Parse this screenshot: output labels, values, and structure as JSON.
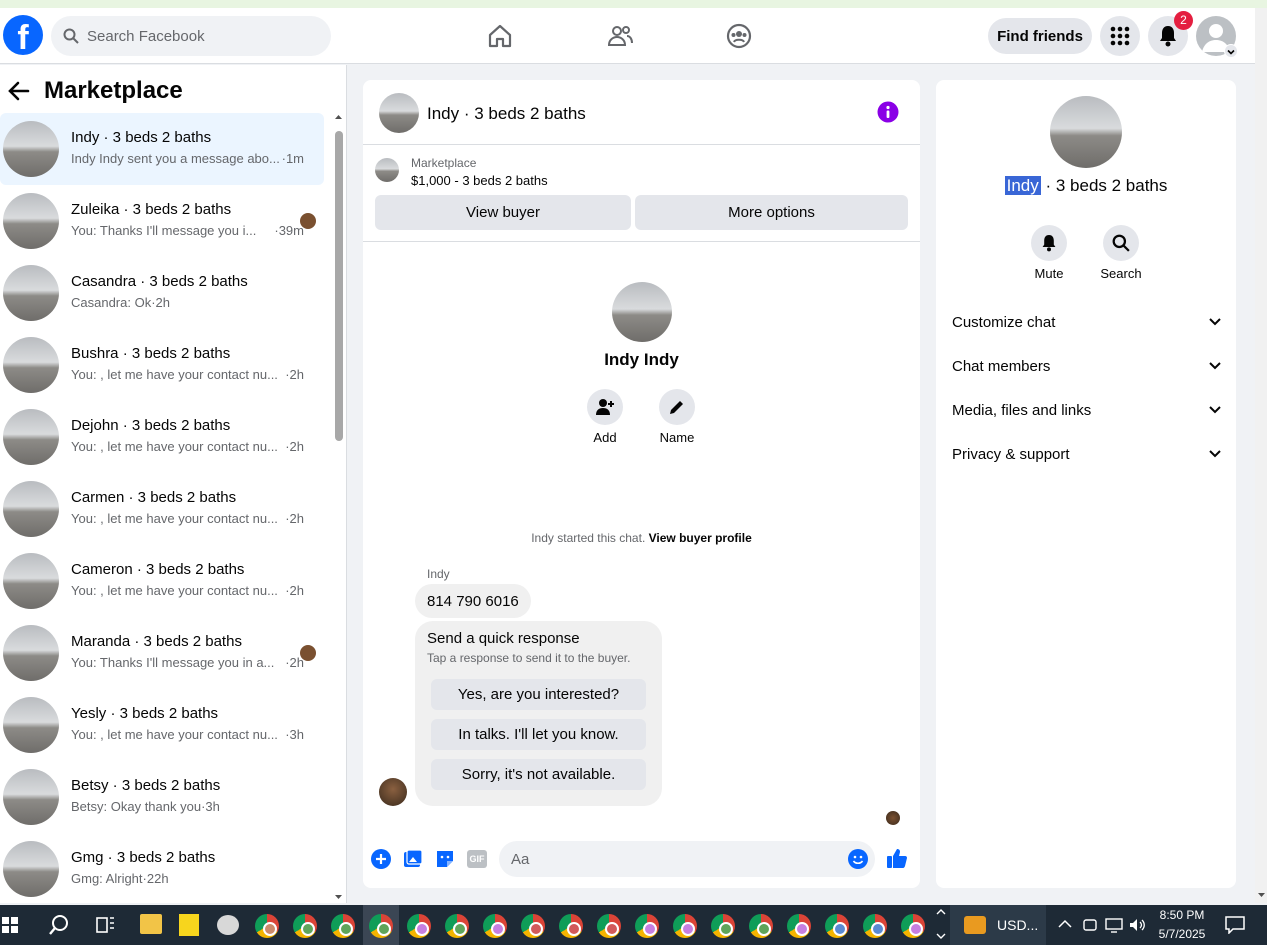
{
  "header": {
    "search_placeholder": "Search Facebook",
    "find_friends": "Find friends",
    "notif_count": "2"
  },
  "left": {
    "title": "Marketplace",
    "conversations": [
      {
        "title": "Indy · 3 beds 2 baths",
        "snippet": "Indy Indy sent you a message abo...",
        "time": "·1m",
        "active": true
      },
      {
        "title": "Zuleika · 3 beds 2 baths",
        "snippet": "You: Thanks I'll message you i...",
        "time": "·39m"
      },
      {
        "title": "Casandra · 3 beds 2 baths",
        "snippet": "Casandra: Ok·2h",
        "time": ""
      },
      {
        "title": "Bushra · 3 beds 2 baths",
        "snippet": "You: , let me have your contact nu...",
        "time": "·2h"
      },
      {
        "title": "Dejohn · 3 beds 2 baths",
        "snippet": "You: , let me have your contact nu...",
        "time": "·2h"
      },
      {
        "title": "Carmen · 3 beds 2 baths",
        "snippet": "You: , let me have your contact nu...",
        "time": "·2h"
      },
      {
        "title": "Cameron · 3 beds 2 baths",
        "snippet": "You: , let me have your contact nu...",
        "time": "·2h"
      },
      {
        "title": "Maranda · 3 beds 2 baths",
        "snippet": "You: Thanks I'll message you in a...",
        "time": "·2h"
      },
      {
        "title": "Yesly · 3 beds 2 baths",
        "snippet": "You: , let me have your contact nu...",
        "time": "·3h"
      },
      {
        "title": "Betsy · 3 beds 2 baths",
        "snippet": "Betsy: Okay thank you·3h",
        "time": ""
      },
      {
        "title": "Gmg · 3 beds 2 baths",
        "snippet": "Gmg: Alright·22h",
        "time": ""
      }
    ]
  },
  "chat": {
    "title": "Indy · 3 beds 2 baths",
    "mp_label": "Marketplace",
    "mp_price": "$1,000 - 3 beds 2 baths",
    "view_buyer": "View buyer",
    "more_options": "More options",
    "profile_name": "Indy Indy",
    "add_label": "Add",
    "name_label": "Name",
    "started_text": "Indy started this chat.",
    "view_profile": "View buyer profile",
    "sender": "Indy",
    "message": "814 790 6016",
    "qr_title": "Send a quick response",
    "qr_sub": "Tap a response to send it to the buyer.",
    "quick_replies": [
      "Yes, are you interested?",
      "In talks. I'll let you know.",
      "Sorry, it's not available."
    ],
    "composer_placeholder": "Aa",
    "gif_label": "GIF"
  },
  "details": {
    "name_highlight": "Indy",
    "name_rest": " · 3 beds 2 baths",
    "mute": "Mute",
    "search": "Search",
    "sections": [
      "Customize chat",
      "Chat members",
      "Media, files and links",
      "Privacy & support"
    ]
  },
  "taskbar": {
    "usd": "USD...",
    "time": "8:50 PM",
    "date": "5/7/2025"
  },
  "colors": {
    "accent": "#0866ff",
    "messenger_purple": "#8a00e6",
    "badge": "#e41e3f"
  }
}
